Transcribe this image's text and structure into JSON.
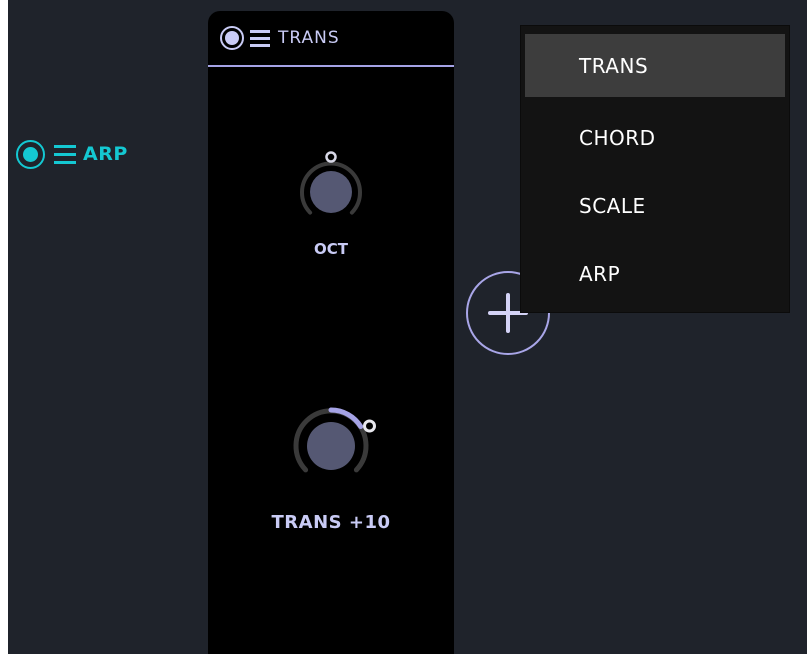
{
  "arp_module": {
    "label": "ARP",
    "enabled": true,
    "accent": "#14c8d2",
    "icons": [
      "power-icon",
      "menu-icon"
    ]
  },
  "trans_module": {
    "label": "TRANS",
    "enabled": true,
    "accent": "#a5a3e6",
    "icons": [
      "power-icon",
      "menu-icon"
    ],
    "knobs": [
      {
        "label": "OCT",
        "value": 0
      },
      {
        "label": "TRANS +10",
        "value": 10
      }
    ]
  },
  "add_button": {
    "icon": "plus-icon"
  },
  "dropdown": {
    "items": [
      "TRANS",
      "CHORD",
      "SCALE",
      "ARP"
    ],
    "highlighted": "TRANS"
  }
}
